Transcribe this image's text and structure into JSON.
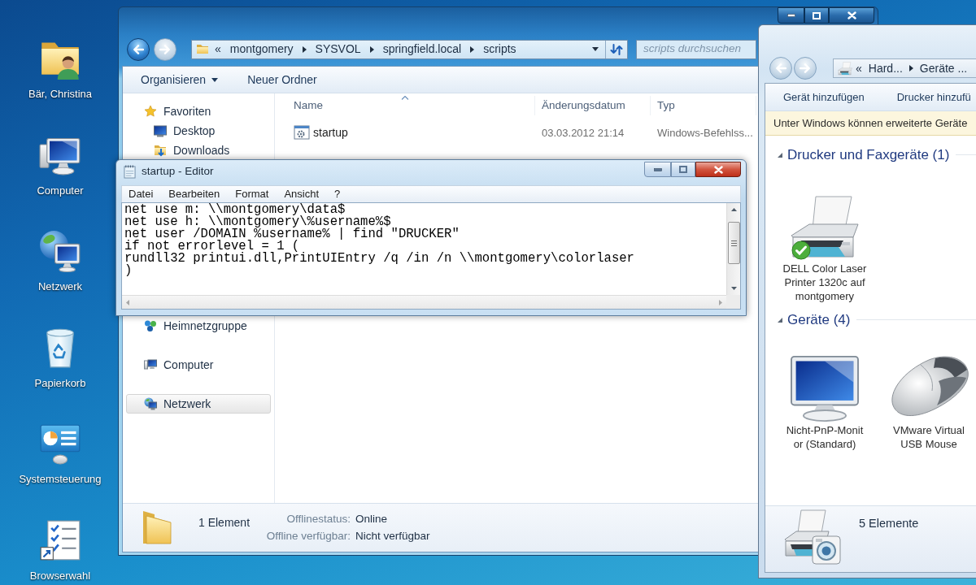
{
  "desktop": {
    "icons": [
      {
        "kind": "user-folder",
        "label": "Bär, Christina"
      },
      {
        "kind": "computer",
        "label": "Computer"
      },
      {
        "kind": "network",
        "label": "Netzwerk"
      },
      {
        "kind": "recycle-bin",
        "label": "Papierkorb"
      },
      {
        "kind": "control-panel",
        "label": "Systemsteuerung"
      },
      {
        "kind": "checklist-shortcut",
        "label": "Browserwahl"
      }
    ]
  },
  "explorer_window": {
    "active": false,
    "nav_buttons": [
      {
        "kind": "back",
        "disabled": false
      },
      {
        "kind": "forward",
        "disabled": true
      }
    ],
    "address_bar": {
      "overflow_marker": "«",
      "segments": [
        "montgomery",
        "SYSVOL",
        "springfield.local",
        "scripts"
      ]
    },
    "search": {
      "placeholder": "scripts durchsuchen"
    },
    "toolbar": [
      {
        "label": "Organisieren",
        "dropdown": true
      },
      {
        "label": "Neuer Ordner",
        "dropdown": false
      }
    ],
    "navigation": [
      {
        "kind": "favorites",
        "label": "Favoriten",
        "selected": false,
        "children": [
          {
            "kind": "desktop",
            "label": "Desktop",
            "selected": false
          },
          {
            "kind": "downloads",
            "label": "Downloads",
            "selected": false
          }
        ]
      },
      {
        "kind": "homegroup",
        "label": "Heimnetzgruppe",
        "selected": false
      },
      {
        "kind": "computer",
        "label": "Computer",
        "selected": false
      },
      {
        "kind": "network",
        "label": "Netzwerk",
        "selected": true
      }
    ],
    "columns": [
      {
        "label": "Name",
        "sorted": true
      },
      {
        "label": "Änderungsdatum",
        "sorted": false
      },
      {
        "label": "Typ",
        "sorted": false
      }
    ],
    "files": [
      {
        "name": "startup",
        "modified": "03.03.2012 21:14",
        "type": "Windows-Befehlss..."
      }
    ],
    "status_bar": {
      "count": "1 Element",
      "details": [
        {
          "label": "Offlinestatus:",
          "value": "Online"
        },
        {
          "label": "Offline verfügbar:",
          "value": "Nicht verfügbar"
        }
      ]
    }
  },
  "notepad_window": {
    "title": "startup - Editor",
    "active": true,
    "menu": [
      "Datei",
      "Bearbeiten",
      "Format",
      "Ansicht",
      "?"
    ],
    "lines": [
      "net use m: \\\\montgomery\\data$",
      "net use h: \\\\montgomery\\%username%$",
      "net user /DOMAIN %username% | find \"DRUCKER\"",
      "if not errorlevel = 1 (",
      "rundll32 printui.dll,PrintUIEntry /q /in /n \\\\montgomery\\colorlaser",
      ")"
    ]
  },
  "devices_window": {
    "nav_buttons": [
      {
        "kind": "back",
        "disabled": true
      },
      {
        "kind": "forward",
        "disabled": true
      }
    ],
    "address_bar": {
      "overflow_marker": "«",
      "segments": [
        "Hard...",
        "Geräte ..."
      ]
    },
    "toolbar": [
      "Gerät hinzufügen",
      "Drucker hinzufü"
    ],
    "info_bar": "Unter Windows können erweiterte Geräte",
    "groups": [
      {
        "title": "Drucker und Faxgeräte (1)",
        "expanded": true,
        "items": [
          {
            "kind": "printer",
            "lines": [
              "DELL Color Laser",
              "Printer 1320c auf",
              "montgomery"
            ],
            "default": true
          }
        ]
      },
      {
        "title": "Geräte (4)",
        "expanded": true,
        "items": [
          {
            "kind": "monitor",
            "lines": [
              "Nicht-PnP-Monit",
              "or (Standard)"
            ],
            "default": false
          },
          {
            "kind": "mouse",
            "lines": [
              "VMware Virtual",
              "USB Mouse"
            ],
            "default": false
          }
        ]
      }
    ],
    "status_bar": {
      "count": "5 Elemente"
    }
  }
}
